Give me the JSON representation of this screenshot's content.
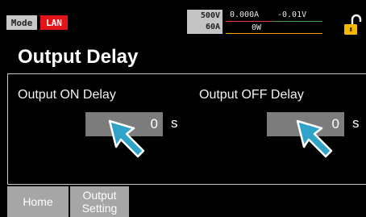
{
  "status": {
    "mode_label": "Mode",
    "lan_label": "LAN",
    "voltage_limit": "500V",
    "current_limit": "60A",
    "current_reading": "0.000A",
    "voltage_reading": "-0.01V",
    "power_reading": "0W"
  },
  "page": {
    "title": "Output Delay"
  },
  "delay": {
    "on_label": "Output ON Delay",
    "on_value": "0",
    "on_unit": "s",
    "off_label": "Output OFF Delay",
    "off_value": "0",
    "off_unit": "s"
  },
  "tabs": {
    "home": "Home",
    "output_line1": "Output",
    "output_line2": "Setting"
  },
  "icons": {
    "lock": "unlocked-padlock-icon",
    "pointer": "cursor-arrow-icon"
  },
  "colors": {
    "background": "#000000",
    "lan_badge": "#e2141a",
    "current_line": "#e53935",
    "voltage_line": "#43a047",
    "power_line": "#f4a300",
    "lock": "#f5b800",
    "pointer": "#2fa3c8",
    "field": "#7c7c7c",
    "tab": "#a6a6a6"
  }
}
